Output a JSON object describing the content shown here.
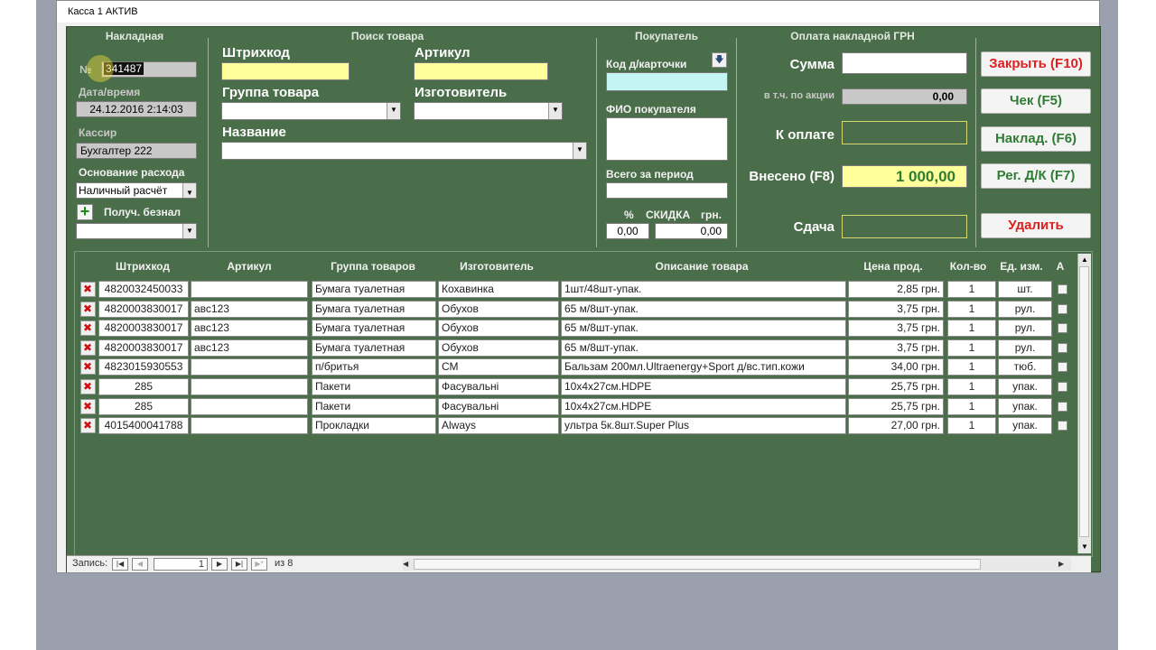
{
  "window": {
    "title": "Касса 1 АКТИВ"
  },
  "invoice": {
    "section_title": "Накладная",
    "number_label": "№",
    "number_value": "341487",
    "datetime_label": "Дата/время",
    "datetime_value": "24.12.2016 2:14:03",
    "cashier_label": "Кассир",
    "cashier_value": "Бухгалтер 222",
    "expense_basis_label": "Основание расхода",
    "expense_basis_value": "Наличный расчёт",
    "cashless_label": "Получ. безнал",
    "cashless_value": ""
  },
  "search": {
    "section_title": "Поиск товара",
    "barcode_label": "Штрихкод",
    "article_label": "Артикул",
    "group_label": "Группа товара",
    "manufacturer_label": "Изготовитель",
    "name_label": "Название"
  },
  "buyer": {
    "section_title": "Покупатель",
    "card_label": "Код д/карточки",
    "name_label": "ФИО покупателя",
    "period_total_label": "Всего за период",
    "discount_pct_label": "%",
    "discount_label": "СКИДКА",
    "discount_uah_label": "грн.",
    "discount_pct_value": "0,00",
    "discount_uah_value": "0,00"
  },
  "payment": {
    "section_title": "Оплата накладной ГРН",
    "sum_label": "Сумма",
    "sum_value": "",
    "promo_label": "в т.ч. по акции",
    "promo_value": "0,00",
    "to_pay_label": "К оплате",
    "to_pay_value": "",
    "paid_label": "Внесено (F8)",
    "paid_value": "1 000,00",
    "change_label": "Сдача",
    "change_value": ""
  },
  "actions": {
    "close": "Закрыть (F10)",
    "receipt": "Чек  (F5)",
    "invoice": "Наклад. (F6)",
    "register_card": "Рег. Д/К (F7)",
    "delete": "Удалить"
  },
  "colors": {
    "panel_green": "#4a6e4a",
    "red_button_text": "#e02020",
    "green_button_text": "#2e7d32",
    "yellow_field": "#ffff9c"
  },
  "table": {
    "headers": [
      "Штрихкод",
      "Артикул",
      "Группа товаров",
      "Изготовитель",
      "Описание товара",
      "Цена прод.",
      "Кол-во",
      "Ед. изм.",
      "А"
    ],
    "rows": [
      {
        "barcode": "4820032450033",
        "article": "",
        "group": "Бумага туалетная",
        "maker": "Кохавинка",
        "desc": "1шт/48шт-упак.",
        "price": "2,85 грн.",
        "qty": "1",
        "unit": "шт."
      },
      {
        "barcode": "4820003830017",
        "article": "авс123",
        "group": "Бумага туалетная",
        "maker": "Обухов",
        "desc": "65 м/8шт-упак.",
        "price": "3,75 грн.",
        "qty": "1",
        "unit": "рул."
      },
      {
        "barcode": "4820003830017",
        "article": "авс123",
        "group": "Бумага туалетная",
        "maker": "Обухов",
        "desc": "65 м/8шт-упак.",
        "price": "3,75 грн.",
        "qty": "1",
        "unit": "рул."
      },
      {
        "barcode": "4820003830017",
        "article": "авс123",
        "group": "Бумага туалетная",
        "maker": "Обухов",
        "desc": "65 м/8шт-упак.",
        "price": "3,75 грн.",
        "qty": "1",
        "unit": "рул."
      },
      {
        "barcode": "4823015930553",
        "article": "",
        "group": "п/бритья",
        "maker": "СМ",
        "desc": "Бальзам 200мл.Ultraenergy+Sport д/вс.тип.кожи",
        "price": "34,00 грн.",
        "qty": "1",
        "unit": "тюб."
      },
      {
        "barcode": "285",
        "article": "",
        "group": "Пакети",
        "maker": "Фасувальні",
        "desc": "10х4х27см.HDPE",
        "price": "25,75 грн.",
        "qty": "1",
        "unit": "упак."
      },
      {
        "barcode": "285",
        "article": "",
        "group": "Пакети",
        "maker": "Фасувальні",
        "desc": "10х4х27см.HDPE",
        "price": "25,75 грн.",
        "qty": "1",
        "unit": "упак."
      },
      {
        "barcode": "4015400041788",
        "article": "",
        "group": "Прокладки",
        "maker": "Always",
        "desc": "ультра 5к.8шт.Super Plus",
        "price": "27,00 грн.",
        "qty": "1",
        "unit": "упак."
      }
    ]
  },
  "record_nav": {
    "label": "Запись:",
    "current": "1",
    "of_label": "из 8"
  }
}
